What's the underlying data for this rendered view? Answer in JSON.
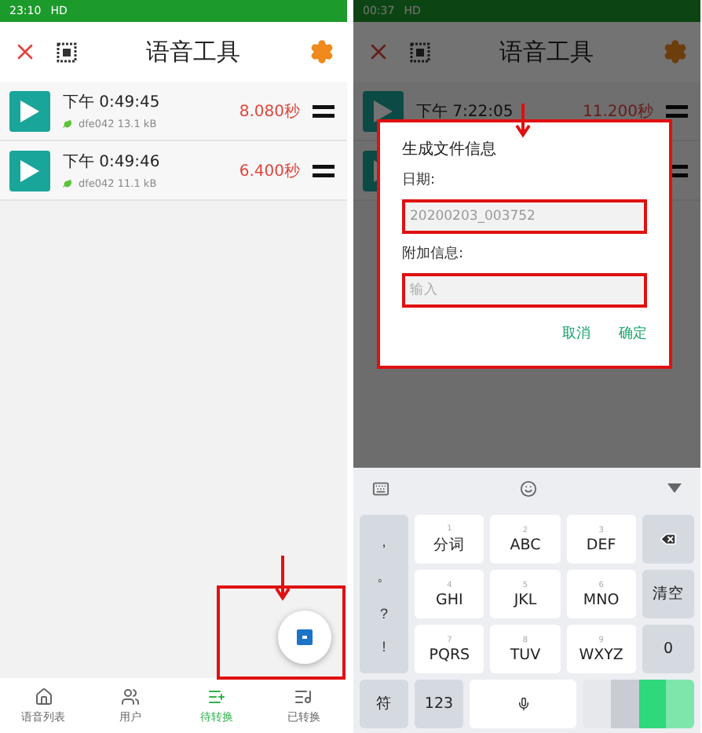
{
  "left_screen": {
    "status_bar": {
      "time": "23:10",
      "network": "HD"
    },
    "toolbar": {
      "title": "语音工具"
    },
    "recordings": [
      {
        "time": "下午 0:49:45",
        "file": "dfe042 13.1 kB",
        "duration": "8.080秒"
      },
      {
        "time": "下午 0:49:46",
        "file": "dfe042 11.1 kB",
        "duration": "6.400秒"
      }
    ],
    "bottom_nav": [
      {
        "label": "语音列表",
        "kind": "home",
        "selected": false
      },
      {
        "label": "用户",
        "kind": "users",
        "selected": false
      },
      {
        "label": "待转换",
        "kind": "pending",
        "selected": true
      },
      {
        "label": "已转换",
        "kind": "done",
        "selected": false
      }
    ]
  },
  "right_screen": {
    "status_bar": {
      "time": "00:37",
      "network": "HD"
    },
    "toolbar": {
      "title": "语音工具"
    },
    "recordings": [
      {
        "time": "下午 7:22:05",
        "duration": "11.200秒"
      }
    ],
    "dialog": {
      "title": "生成文件信息",
      "date_label": "日期:",
      "date_value": "20200203_003752",
      "note_label": "附加信息:",
      "note_placeholder": "输入",
      "buttons": [
        "取消",
        "确定"
      ]
    },
    "keyboard": {
      "symbol_keys": [
        ",",
        "。",
        "?",
        "!"
      ],
      "keys": [
        {
          "label": "分词",
          "digit": "1"
        },
        {
          "label": "ABC",
          "digit": "2"
        },
        {
          "label": "DEF",
          "digit": "3"
        },
        {
          "label": "GHI",
          "digit": "4"
        },
        {
          "label": "JKL",
          "digit": "5"
        },
        {
          "label": "MNO",
          "digit": "6"
        },
        {
          "label": "PQRS",
          "digit": "7"
        },
        {
          "label": "TUV",
          "digit": "8"
        },
        {
          "label": "WXYZ",
          "digit": "9"
        }
      ],
      "clear_key": "清空",
      "zero_key": "0",
      "symbols_key": "符",
      "numbers_key": "123"
    }
  }
}
